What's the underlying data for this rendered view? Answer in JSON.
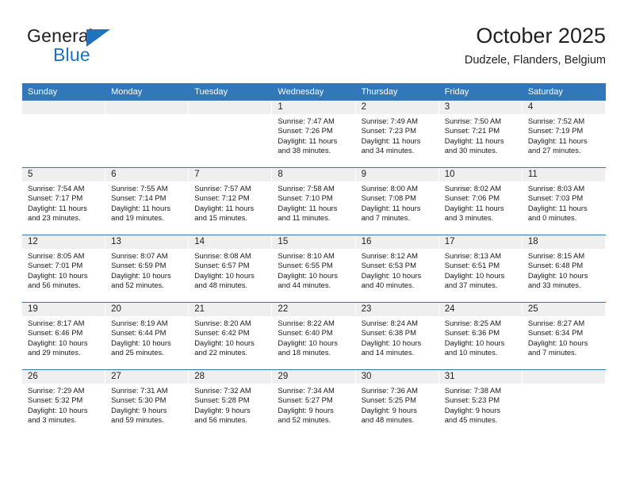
{
  "brand": {
    "name_top": "General",
    "name_bottom": "Blue",
    "accent_color": "#1f72bd"
  },
  "header": {
    "title": "October 2025",
    "subtitle": "Dudzele, Flanders, Belgium"
  },
  "theme": {
    "header_row_bg": "#3277b9",
    "daynum_bg": "#efefef",
    "grid_line": "#3277b9"
  },
  "weekday_headers": [
    "Sunday",
    "Monday",
    "Tuesday",
    "Wednesday",
    "Thursday",
    "Friday",
    "Saturday"
  ],
  "weeks": [
    [
      {
        "day": "",
        "sunrise": "",
        "sunset": "",
        "daylight_a": "",
        "daylight_b": ""
      },
      {
        "day": "",
        "sunrise": "",
        "sunset": "",
        "daylight_a": "",
        "daylight_b": ""
      },
      {
        "day": "",
        "sunrise": "",
        "sunset": "",
        "daylight_a": "",
        "daylight_b": ""
      },
      {
        "day": "1",
        "sunrise": "Sunrise: 7:47 AM",
        "sunset": "Sunset: 7:26 PM",
        "daylight_a": "Daylight: 11 hours",
        "daylight_b": "and 38 minutes."
      },
      {
        "day": "2",
        "sunrise": "Sunrise: 7:49 AM",
        "sunset": "Sunset: 7:23 PM",
        "daylight_a": "Daylight: 11 hours",
        "daylight_b": "and 34 minutes."
      },
      {
        "day": "3",
        "sunrise": "Sunrise: 7:50 AM",
        "sunset": "Sunset: 7:21 PM",
        "daylight_a": "Daylight: 11 hours",
        "daylight_b": "and 30 minutes."
      },
      {
        "day": "4",
        "sunrise": "Sunrise: 7:52 AM",
        "sunset": "Sunset: 7:19 PM",
        "daylight_a": "Daylight: 11 hours",
        "daylight_b": "and 27 minutes."
      }
    ],
    [
      {
        "day": "5",
        "sunrise": "Sunrise: 7:54 AM",
        "sunset": "Sunset: 7:17 PM",
        "daylight_a": "Daylight: 11 hours",
        "daylight_b": "and 23 minutes."
      },
      {
        "day": "6",
        "sunrise": "Sunrise: 7:55 AM",
        "sunset": "Sunset: 7:14 PM",
        "daylight_a": "Daylight: 11 hours",
        "daylight_b": "and 19 minutes."
      },
      {
        "day": "7",
        "sunrise": "Sunrise: 7:57 AM",
        "sunset": "Sunset: 7:12 PM",
        "daylight_a": "Daylight: 11 hours",
        "daylight_b": "and 15 minutes."
      },
      {
        "day": "8",
        "sunrise": "Sunrise: 7:58 AM",
        "sunset": "Sunset: 7:10 PM",
        "daylight_a": "Daylight: 11 hours",
        "daylight_b": "and 11 minutes."
      },
      {
        "day": "9",
        "sunrise": "Sunrise: 8:00 AM",
        "sunset": "Sunset: 7:08 PM",
        "daylight_a": "Daylight: 11 hours",
        "daylight_b": "and 7 minutes."
      },
      {
        "day": "10",
        "sunrise": "Sunrise: 8:02 AM",
        "sunset": "Sunset: 7:06 PM",
        "daylight_a": "Daylight: 11 hours",
        "daylight_b": "and 3 minutes."
      },
      {
        "day": "11",
        "sunrise": "Sunrise: 8:03 AM",
        "sunset": "Sunset: 7:03 PM",
        "daylight_a": "Daylight: 11 hours",
        "daylight_b": "and 0 minutes."
      }
    ],
    [
      {
        "day": "12",
        "sunrise": "Sunrise: 8:05 AM",
        "sunset": "Sunset: 7:01 PM",
        "daylight_a": "Daylight: 10 hours",
        "daylight_b": "and 56 minutes."
      },
      {
        "day": "13",
        "sunrise": "Sunrise: 8:07 AM",
        "sunset": "Sunset: 6:59 PM",
        "daylight_a": "Daylight: 10 hours",
        "daylight_b": "and 52 minutes."
      },
      {
        "day": "14",
        "sunrise": "Sunrise: 8:08 AM",
        "sunset": "Sunset: 6:57 PM",
        "daylight_a": "Daylight: 10 hours",
        "daylight_b": "and 48 minutes."
      },
      {
        "day": "15",
        "sunrise": "Sunrise: 8:10 AM",
        "sunset": "Sunset: 6:55 PM",
        "daylight_a": "Daylight: 10 hours",
        "daylight_b": "and 44 minutes."
      },
      {
        "day": "16",
        "sunrise": "Sunrise: 8:12 AM",
        "sunset": "Sunset: 6:53 PM",
        "daylight_a": "Daylight: 10 hours",
        "daylight_b": "and 40 minutes."
      },
      {
        "day": "17",
        "sunrise": "Sunrise: 8:13 AM",
        "sunset": "Sunset: 6:51 PM",
        "daylight_a": "Daylight: 10 hours",
        "daylight_b": "and 37 minutes."
      },
      {
        "day": "18",
        "sunrise": "Sunrise: 8:15 AM",
        "sunset": "Sunset: 6:48 PM",
        "daylight_a": "Daylight: 10 hours",
        "daylight_b": "and 33 minutes."
      }
    ],
    [
      {
        "day": "19",
        "sunrise": "Sunrise: 8:17 AM",
        "sunset": "Sunset: 6:46 PM",
        "daylight_a": "Daylight: 10 hours",
        "daylight_b": "and 29 minutes."
      },
      {
        "day": "20",
        "sunrise": "Sunrise: 8:19 AM",
        "sunset": "Sunset: 6:44 PM",
        "daylight_a": "Daylight: 10 hours",
        "daylight_b": "and 25 minutes."
      },
      {
        "day": "21",
        "sunrise": "Sunrise: 8:20 AM",
        "sunset": "Sunset: 6:42 PM",
        "daylight_a": "Daylight: 10 hours",
        "daylight_b": "and 22 minutes."
      },
      {
        "day": "22",
        "sunrise": "Sunrise: 8:22 AM",
        "sunset": "Sunset: 6:40 PM",
        "daylight_a": "Daylight: 10 hours",
        "daylight_b": "and 18 minutes."
      },
      {
        "day": "23",
        "sunrise": "Sunrise: 8:24 AM",
        "sunset": "Sunset: 6:38 PM",
        "daylight_a": "Daylight: 10 hours",
        "daylight_b": "and 14 minutes."
      },
      {
        "day": "24",
        "sunrise": "Sunrise: 8:25 AM",
        "sunset": "Sunset: 6:36 PM",
        "daylight_a": "Daylight: 10 hours",
        "daylight_b": "and 10 minutes."
      },
      {
        "day": "25",
        "sunrise": "Sunrise: 8:27 AM",
        "sunset": "Sunset: 6:34 PM",
        "daylight_a": "Daylight: 10 hours",
        "daylight_b": "and 7 minutes."
      }
    ],
    [
      {
        "day": "26",
        "sunrise": "Sunrise: 7:29 AM",
        "sunset": "Sunset: 5:32 PM",
        "daylight_a": "Daylight: 10 hours",
        "daylight_b": "and 3 minutes."
      },
      {
        "day": "27",
        "sunrise": "Sunrise: 7:31 AM",
        "sunset": "Sunset: 5:30 PM",
        "daylight_a": "Daylight: 9 hours",
        "daylight_b": "and 59 minutes."
      },
      {
        "day": "28",
        "sunrise": "Sunrise: 7:32 AM",
        "sunset": "Sunset: 5:28 PM",
        "daylight_a": "Daylight: 9 hours",
        "daylight_b": "and 56 minutes."
      },
      {
        "day": "29",
        "sunrise": "Sunrise: 7:34 AM",
        "sunset": "Sunset: 5:27 PM",
        "daylight_a": "Daylight: 9 hours",
        "daylight_b": "and 52 minutes."
      },
      {
        "day": "30",
        "sunrise": "Sunrise: 7:36 AM",
        "sunset": "Sunset: 5:25 PM",
        "daylight_a": "Daylight: 9 hours",
        "daylight_b": "and 48 minutes."
      },
      {
        "day": "31",
        "sunrise": "Sunrise: 7:38 AM",
        "sunset": "Sunset: 5:23 PM",
        "daylight_a": "Daylight: 9 hours",
        "daylight_b": "and 45 minutes."
      },
      {
        "day": "",
        "sunrise": "",
        "sunset": "",
        "daylight_a": "",
        "daylight_b": ""
      }
    ]
  ]
}
